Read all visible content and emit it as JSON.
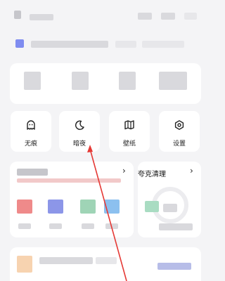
{
  "quick_actions": [
    {
      "label": "无痕",
      "icon": "ghost-icon"
    },
    {
      "label": "暗夜",
      "icon": "moon-icon"
    },
    {
      "label": "壁纸",
      "icon": "book-icon"
    },
    {
      "label": "设置",
      "icon": "gear-icon"
    }
  ],
  "cleaner_card": {
    "title": "夸克清理",
    "chevron": "›"
  },
  "left_card": {
    "chevron": "›"
  },
  "colors": {
    "annotation": "#e53935",
    "background": "#f4f4f6",
    "card": "#ffffff"
  }
}
